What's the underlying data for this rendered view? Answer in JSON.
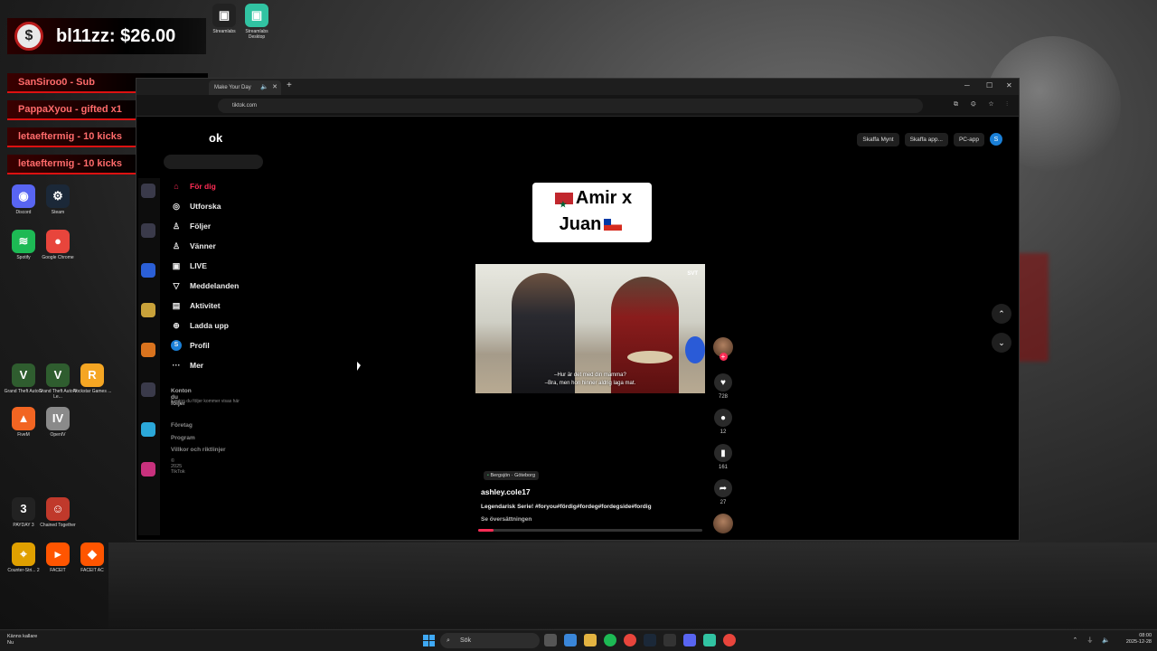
{
  "overlay": {
    "donation_icon": "$",
    "donation": "bl11zz: $26.00",
    "events": [
      "SanSiroo0 - Sub",
      "PappaXyou - gifted x1",
      "letaeftermig - 10 kicks",
      "letaeftermig - 10 kicks"
    ]
  },
  "desktop_icons": [
    {
      "label": "Discord",
      "glyph": "◉",
      "color": "#5865f2"
    },
    {
      "label": "Steam",
      "glyph": "⚙",
      "color": "#1b2838"
    },
    {
      "label": "Spotify",
      "glyph": "≋",
      "color": "#1db954"
    },
    {
      "label": "Google Chrome",
      "glyph": "●",
      "color": "#e8453c"
    },
    {
      "label": "Grand Theft Auto V",
      "glyph": "V",
      "color": "#2f5d2f"
    },
    {
      "label": "Grand Theft Auto V Le...",
      "glyph": "V",
      "color": "#2f5d2f"
    },
    {
      "label": "Rockstar Games ...",
      "glyph": "R",
      "color": "#f5a623"
    },
    {
      "label": "FiveM",
      "glyph": "▲",
      "color": "#f26522"
    },
    {
      "label": "OpenIV",
      "glyph": "IV",
      "color": "#8a8a8a"
    },
    {
      "label": "PAYDAY 3",
      "glyph": "3",
      "color": "#222"
    },
    {
      "label": "Chained Together",
      "glyph": "☺",
      "color": "#c0392b"
    },
    {
      "label": "Counter-Stri... 2",
      "glyph": "⌖",
      "color": "#e0a000"
    },
    {
      "label": "FACEIT",
      "glyph": "▸",
      "color": "#ff5500"
    },
    {
      "label": "FACEIT AC",
      "glyph": "◆",
      "color": "#ff5500"
    }
  ],
  "top_icons": [
    "Streamlabs",
    "Streamlabs Desktop"
  ],
  "browser": {
    "tab_title": "Make Your Day",
    "tab_audio": "🔈",
    "tab_close": "✕",
    "new_tab": "+",
    "win_min": "─",
    "win_max": "☐",
    "win_close": "✕",
    "url": "tiktok.com",
    "toolbar_icons": "⧉ ⚙ ☆ ⋮"
  },
  "tiktok": {
    "logo": "ok",
    "top_buttons": [
      "Skaffa Mynt",
      "Skaffa app...",
      "PC-app"
    ],
    "profile_initial": "S",
    "nav": [
      {
        "label": "För dig",
        "icon": "⌂"
      },
      {
        "label": "Utforska",
        "icon": "◎"
      },
      {
        "label": "Följer",
        "icon": "♙"
      },
      {
        "label": "Vänner",
        "icon": "♙"
      },
      {
        "label": "LIVE",
        "icon": "▣"
      },
      {
        "label": "Meddelanden",
        "icon": "▽"
      },
      {
        "label": "Aktivitet",
        "icon": "▤"
      },
      {
        "label": "Ladda upp",
        "icon": "⊕"
      },
      {
        "label": "Profil",
        "icon": "S"
      },
      {
        "label": "Mer",
        "icon": "···"
      }
    ],
    "following_heading": "Konton du följer",
    "following_sub": "Konton du följer kommer visas här",
    "footer": [
      "Företag",
      "Program",
      "Villkor och riktlinjer"
    ],
    "copyright": "© 2025 TikTok"
  },
  "video": {
    "caption_line1": "Amir x",
    "caption_line2": "Juan",
    "watermark": "SVT",
    "subtitle1": "–Hur är det med din mamma?",
    "subtitle2": "–Bra, men hon hinner aldrig laga mat.",
    "location": "Bergsjön · Göteborg",
    "location_icon": "▪",
    "handle": "ashley.cole17",
    "description": "Legendarisk Serie! #foryou#fördig#fordeg#fordegside#fordig",
    "translate": "Se översättningen",
    "progress": 0.07,
    "likes": "728",
    "comments": "12",
    "saves": "161",
    "shares": "27",
    "like_icon": "♥",
    "comment_icon": "●",
    "save_icon": "▮",
    "share_icon": "➦",
    "follow_plus": "+",
    "nav_up": "⌃",
    "nav_down": "⌄"
  },
  "taskbar": {
    "weather_line1": "Känns kallare",
    "weather_line2": "Nu",
    "search": "Sök",
    "search_icon": "⌕",
    "tray_icons": "⌃ ⏚ 🔈",
    "time": "08:00",
    "date": "2025-12-28"
  }
}
